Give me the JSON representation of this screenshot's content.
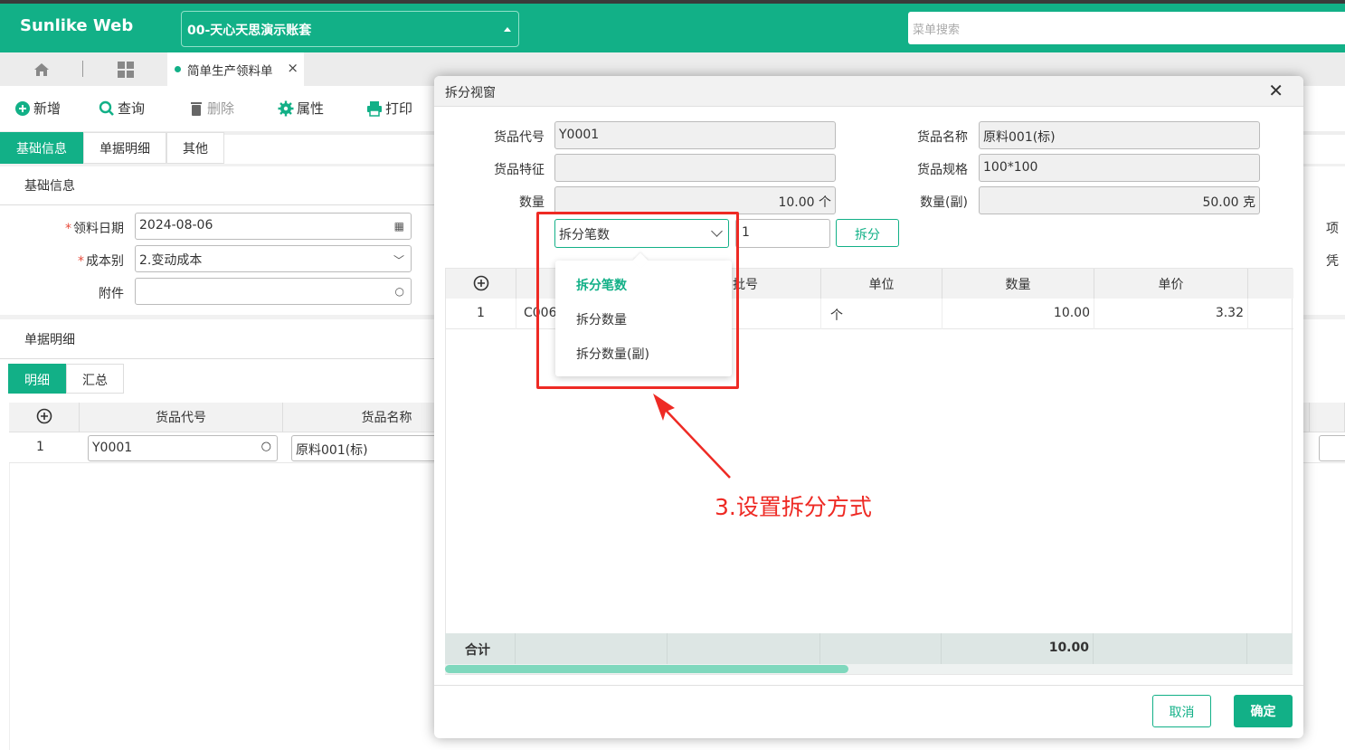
{
  "app": {
    "brand": "Sunlike Web",
    "account": "00-天心天思演示账套",
    "menu_search_placeholder": "菜单搜索"
  },
  "tabs": {
    "doc_tab": "简单生产领料单"
  },
  "toolbar": {
    "add": "新增",
    "query": "查询",
    "delete": "删除",
    "props": "属性",
    "print": "打印"
  },
  "section_tabs": [
    "基础信息",
    "单据明细",
    "其他"
  ],
  "basic": {
    "title": "基础信息",
    "date_label": "领料日期",
    "date_value": "2024-08-06",
    "cost_label": "成本别",
    "cost_value": "2.变动成本",
    "attach_label": "附件"
  },
  "detail": {
    "title": "单据明细",
    "sub_tabs": [
      "明细",
      "汇总"
    ],
    "columns": [
      "货品代号",
      "货品名称"
    ],
    "row": {
      "index": "1",
      "code": "Y0001",
      "name": "原料001(标)"
    }
  },
  "right_labels": [
    "项",
    "凭"
  ],
  "modal": {
    "title": "拆分视窗",
    "code_label": "货品代号",
    "code_value": "Y0001",
    "name_label": "货品名称",
    "name_value": "原料001(标)",
    "feature_label": "货品特征",
    "feature_value": "",
    "spec_label": "货品规格",
    "spec_value": "100*100",
    "qty_label": "数量",
    "qty_value": "10.00 个",
    "qty2_label": "数量(副)",
    "qty2_value": "50.00 克",
    "split_mode": "拆分笔数",
    "split_count": "1",
    "split_button": "拆分",
    "grid_columns": [
      "批号",
      "单位",
      "数量",
      "单价"
    ],
    "grid_row": {
      "index": "1",
      "code": "C006",
      "unit": "个",
      "qty": "10.00",
      "price": "3.32"
    },
    "footer_label": "合计",
    "footer_qty": "10.00",
    "cancel": "取消",
    "ok": "确定"
  },
  "dropdown": {
    "options": [
      "拆分笔数",
      "拆分数量",
      "拆分数量(副)"
    ],
    "selected_index": 0
  },
  "annotation": {
    "text": "3.设置拆分方式",
    "color": "#ee2a24"
  },
  "colors": {
    "accent": "#12b087"
  }
}
